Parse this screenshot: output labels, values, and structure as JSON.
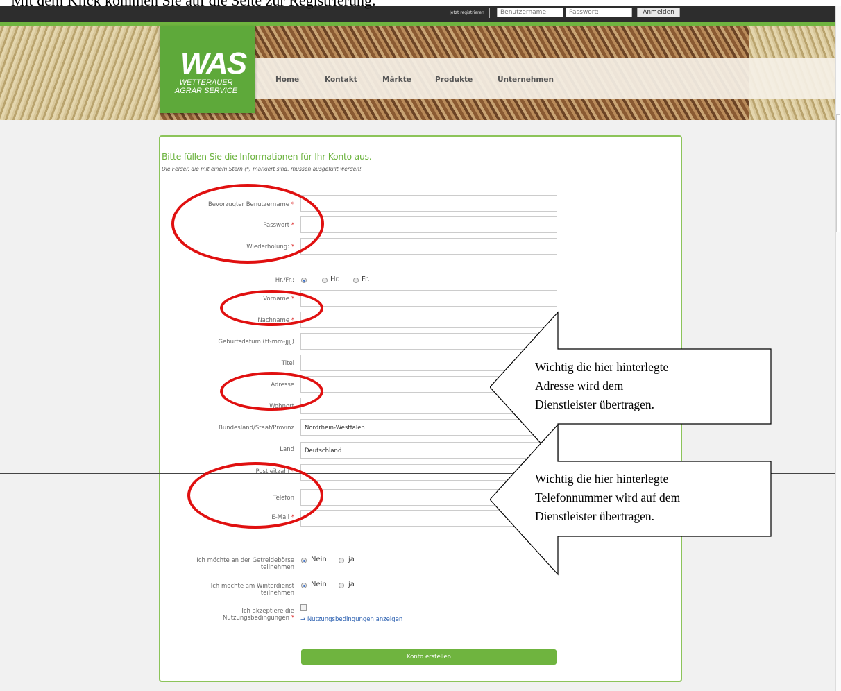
{
  "caption": "Mit dem Klick kommen Sie auf die Seite zur Registrierung.",
  "topbar": {
    "register_link": "Jetzt registrieren",
    "username_placeholder": "Benutzername:",
    "password_placeholder": "Passwort:",
    "login_button": "Anmelden"
  },
  "logo": {
    "text": "WAS",
    "subtitle_line1": "WETTERAUER",
    "subtitle_line2": "AGRAR SERVICE"
  },
  "nav": {
    "items": [
      "Home",
      "Kontakt",
      "Märkte",
      "Produkte",
      "Unternehmen"
    ]
  },
  "form": {
    "title": "Bitte füllen Sie die Informationen für Ihr Konto aus.",
    "subtitle": "Die Felder, die mit einem Stern (*) markiert sind, müssen ausgefüllt werden!",
    "fields": {
      "username": {
        "label": "Bevorzugter Benutzername",
        "required": "*",
        "value": ""
      },
      "password": {
        "label": "Passwort",
        "required": "*",
        "value": ""
      },
      "repeat": {
        "label": "Wiederholung:",
        "required": "*",
        "value": ""
      },
      "salutation": {
        "label": "Hr./Fr.:",
        "options": [
          "Hr.",
          "Fr."
        ],
        "selected": ""
      },
      "firstname": {
        "label": "Vorname",
        "required": "*",
        "value": ""
      },
      "lastname": {
        "label": "Nachname",
        "required": "*",
        "value": ""
      },
      "birthdate": {
        "label": "Geburtsdatum (tt-mm-jjjj)",
        "value": ""
      },
      "title": {
        "label": "Titel",
        "value": ""
      },
      "address": {
        "label": "Adresse",
        "value": ""
      },
      "city": {
        "label": "Wohnort",
        "value": ""
      },
      "state": {
        "label": "Bundesland/Staat/Provinz",
        "value": "Nordrhein-Westfalen"
      },
      "country": {
        "label": "Land",
        "value": "Deutschland"
      },
      "zip": {
        "label": "Postleitzahl",
        "required": "*",
        "value": ""
      },
      "phone": {
        "label": "Telefon",
        "value": ""
      },
      "email": {
        "label": "E-Mail",
        "required": "*",
        "value": ""
      }
    },
    "grain_exchange": {
      "label_line1": "Ich möchte an der Getreidebörse",
      "label_line2": "teilnehmen",
      "options": [
        "Nein",
        "ja"
      ],
      "selected": "Nein"
    },
    "winter_service": {
      "label_line1": "Ich möchte am Winterdienst",
      "label_line2": "teilnehmen",
      "options": [
        "Nein",
        "ja"
      ],
      "selected": "Nein"
    },
    "terms": {
      "label_line1": "Ich akzeptiere die",
      "label_line2": "Nutzungsbedingungen",
      "required": "*",
      "link": "→ Nutzungsbedingungen anzeigen",
      "checked": false
    },
    "submit": "Konto erstellen"
  },
  "callouts": [
    {
      "lines": [
        "Wichtig die hier hinterlegte",
        "Adresse wird dem",
        "Dienstleister übertragen."
      ]
    },
    {
      "lines": [
        "Wichtig die hier hinterlegte",
        "Telefonnummer wird auf dem",
        "Dienstleister übertragen."
      ]
    }
  ],
  "colors": {
    "accent_green": "#6fb43f",
    "annotation_red": "#e01010",
    "link_blue": "#2a5fb0"
  }
}
